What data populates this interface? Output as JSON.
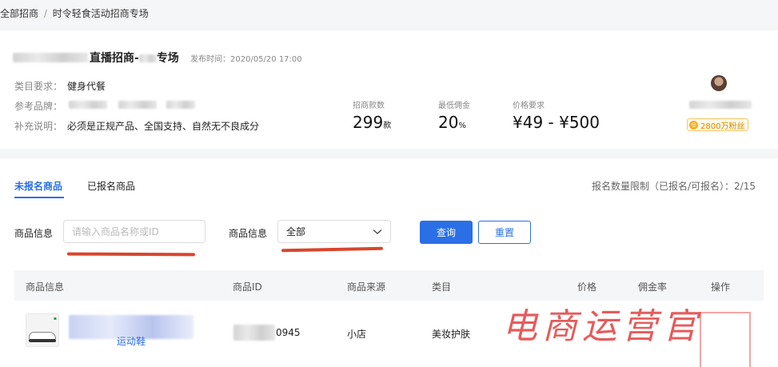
{
  "breadcrumb": {
    "root": "全部招商",
    "sep": "/",
    "current": "时令轻食活动招商专场"
  },
  "campaign": {
    "title": "直播招商-",
    "title_suffix": "专场",
    "publish_time": "发布时间：2020/05/20 17:00",
    "category_label": "类目要求：",
    "category_value": "健身代餐",
    "brand_label": "参考品牌：",
    "note_label": "补充说明：",
    "note_value": "必须是正规产品、全国支持、自然无不良成分",
    "stats": [
      {
        "label": "招商款数",
        "value": "299",
        "unit": "款"
      },
      {
        "label": "最低佣金",
        "value": "20",
        "unit": "%"
      },
      {
        "label": "价格要求",
        "value": "¥49 - ¥500"
      }
    ],
    "fans_badge": "2800万粉丝"
  },
  "tabs": {
    "unregistered": "未报名商品",
    "registered": "已报名商品"
  },
  "limit_text": "报名数量限制（已报名/可报名）：2/15",
  "filters": {
    "product_info_label": "商品信息",
    "search_placeholder": "请输入商品名称或ID",
    "select_label": "商品信息",
    "select_value": "全部",
    "query_button": "查询",
    "reset_button": "重置"
  },
  "table": {
    "headers": [
      "商品信息",
      "商品ID",
      "商品来源",
      "类目",
      "价格",
      "佣金率",
      "操作"
    ],
    "rows": [
      {
        "name_visible": "运动鞋",
        "id_visible": "0945",
        "source": "小店",
        "category": "美妆护肤"
      }
    ]
  },
  "watermark": "电商运营官",
  "colors": {
    "accent": "#2b6fe6",
    "annotation_red": "#d9452b",
    "fans_gold": "#d48a00"
  }
}
